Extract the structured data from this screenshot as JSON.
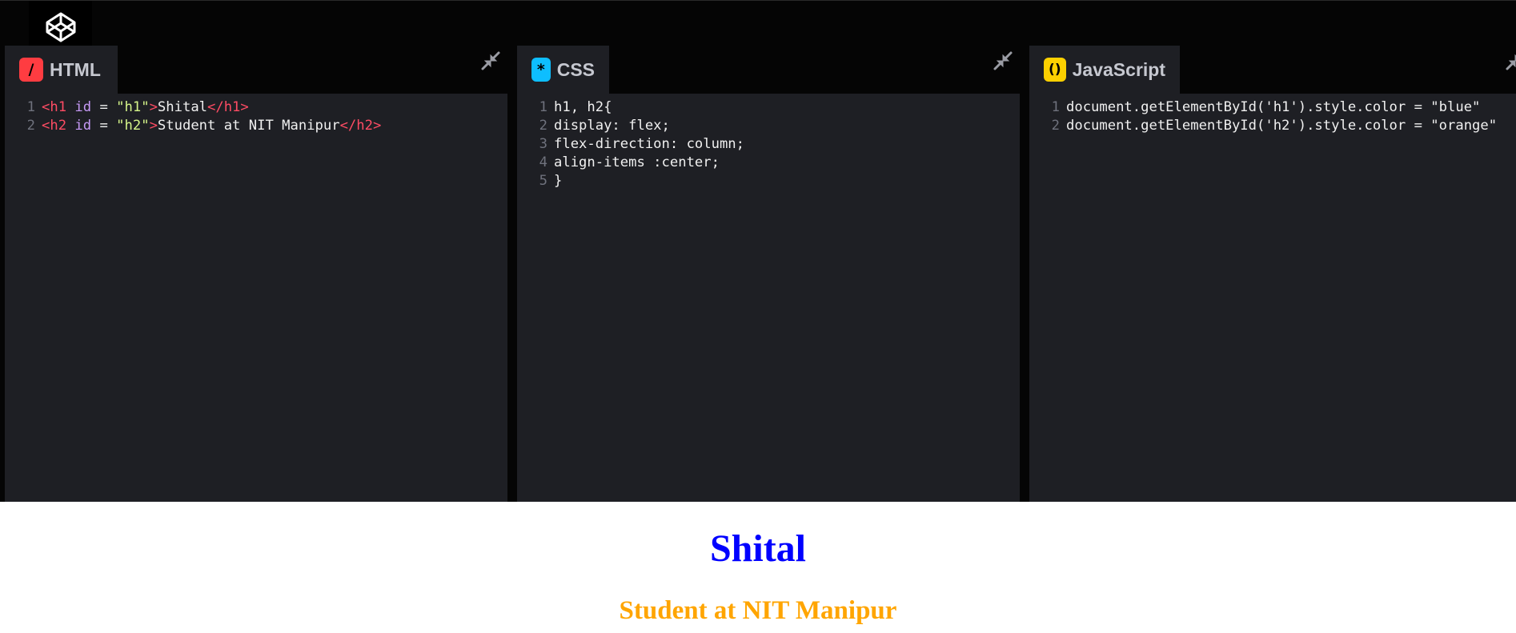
{
  "logo": {
    "icon": "codepen-cube-icon"
  },
  "panes": {
    "html": {
      "label": "HTML",
      "icon_text": "/",
      "icon_color": "#ff3c41",
      "lines": [
        {
          "n": "1",
          "tokens": [
            {
              "t": "<h1 ",
              "c": "tag"
            },
            {
              "t": "id",
              "c": "attr"
            },
            {
              "t": " = ",
              "c": "plain"
            },
            {
              "t": "\"h1\"",
              "c": "str"
            },
            {
              "t": ">",
              "c": "tag"
            },
            {
              "t": "Shital",
              "c": "plain"
            },
            {
              "t": "</h1>",
              "c": "tag"
            }
          ]
        },
        {
          "n": "2",
          "tokens": [
            {
              "t": "<h2 ",
              "c": "tag"
            },
            {
              "t": "id",
              "c": "attr"
            },
            {
              "t": " = ",
              "c": "plain"
            },
            {
              "t": "\"h2\"",
              "c": "str"
            },
            {
              "t": ">",
              "c": "tag"
            },
            {
              "t": "Student at NIT Manipur",
              "c": "plain"
            },
            {
              "t": "</h2>",
              "c": "tag"
            }
          ]
        }
      ]
    },
    "css": {
      "label": "CSS",
      "icon_text": "*",
      "icon_color": "#0ebeff",
      "lines": [
        {
          "n": "1",
          "tokens": [
            {
              "t": "h1, h2{",
              "c": "plain"
            }
          ]
        },
        {
          "n": "2",
          "tokens": [
            {
              "t": "display: flex;",
              "c": "plain"
            }
          ]
        },
        {
          "n": "3",
          "tokens": [
            {
              "t": "flex-direction: column;",
              "c": "plain"
            }
          ]
        },
        {
          "n": "4",
          "tokens": [
            {
              "t": "align-items :center;",
              "c": "plain"
            }
          ]
        },
        {
          "n": "5",
          "tokens": [
            {
              "t": "}",
              "c": "plain"
            }
          ]
        }
      ]
    },
    "js": {
      "label": "JavaScript",
      "icon_text": "()",
      "icon_color": "#fcd000",
      "lines": [
        {
          "n": "1",
          "tokens": [
            {
              "t": "document.getElementById('h1').style.color = \"blue\"",
              "c": "plain"
            }
          ]
        },
        {
          "n": "2",
          "tokens": [
            {
              "t": "document.getElementById('h2').style.color = \"orange\"",
              "c": "plain"
            }
          ]
        }
      ]
    }
  },
  "preview": {
    "h1": "Shital",
    "h2": "Student at NIT Manipur"
  },
  "colors": {
    "editor_bg": "#1e1f24",
    "chrome_bg": "#050505",
    "h1_color": "blue",
    "h2_color": "orange"
  }
}
